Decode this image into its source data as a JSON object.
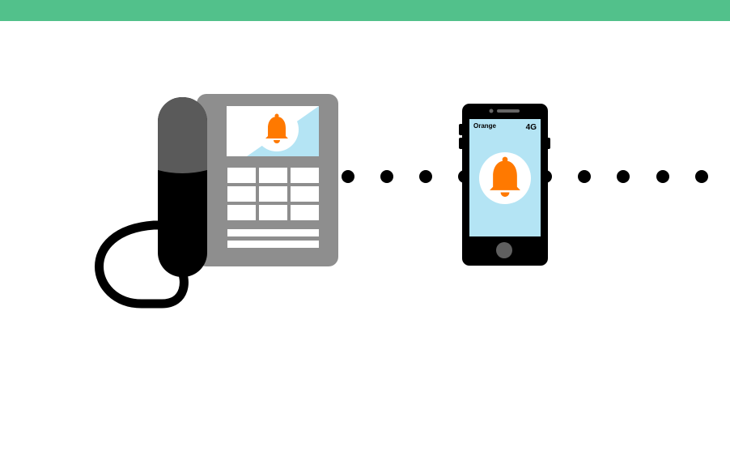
{
  "colors": {
    "top_bar": "#52c18b",
    "desk_phone_body": "#8e8e8e",
    "handset_top": "#5a5a5a",
    "handset_bottom": "#000000",
    "screen_background": "#b4e4f4",
    "bell": "#ff7900",
    "mobile_body": "#000000",
    "home_button": "#5f5f5f",
    "dots": "#000000"
  },
  "icons": {
    "desk_phone": "desk-phone-icon",
    "mobile_phone": "mobile-phone-icon",
    "bell": "bell-icon"
  },
  "mobile": {
    "carrier": "Orange",
    "network": "4G"
  }
}
